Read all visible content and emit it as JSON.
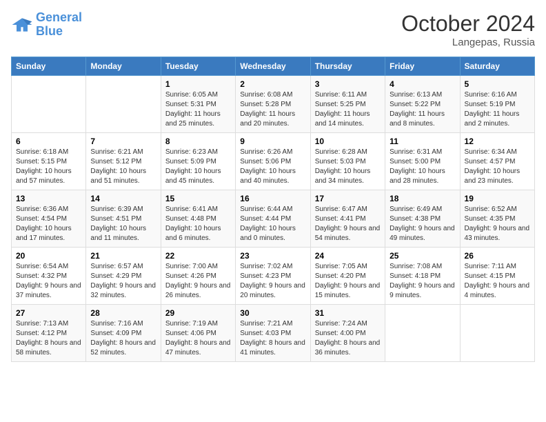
{
  "header": {
    "logo_line1": "General",
    "logo_line2": "Blue",
    "month": "October 2024",
    "location": "Langepas, Russia"
  },
  "weekdays": [
    "Sunday",
    "Monday",
    "Tuesday",
    "Wednesday",
    "Thursday",
    "Friday",
    "Saturday"
  ],
  "weeks": [
    [
      {
        "day": "",
        "sunrise": "",
        "sunset": "",
        "daylight": ""
      },
      {
        "day": "",
        "sunrise": "",
        "sunset": "",
        "daylight": ""
      },
      {
        "day": "1",
        "sunrise": "Sunrise: 6:05 AM",
        "sunset": "Sunset: 5:31 PM",
        "daylight": "Daylight: 11 hours and 25 minutes."
      },
      {
        "day": "2",
        "sunrise": "Sunrise: 6:08 AM",
        "sunset": "Sunset: 5:28 PM",
        "daylight": "Daylight: 11 hours and 20 minutes."
      },
      {
        "day": "3",
        "sunrise": "Sunrise: 6:11 AM",
        "sunset": "Sunset: 5:25 PM",
        "daylight": "Daylight: 11 hours and 14 minutes."
      },
      {
        "day": "4",
        "sunrise": "Sunrise: 6:13 AM",
        "sunset": "Sunset: 5:22 PM",
        "daylight": "Daylight: 11 hours and 8 minutes."
      },
      {
        "day": "5",
        "sunrise": "Sunrise: 6:16 AM",
        "sunset": "Sunset: 5:19 PM",
        "daylight": "Daylight: 11 hours and 2 minutes."
      }
    ],
    [
      {
        "day": "6",
        "sunrise": "Sunrise: 6:18 AM",
        "sunset": "Sunset: 5:15 PM",
        "daylight": "Daylight: 10 hours and 57 minutes."
      },
      {
        "day": "7",
        "sunrise": "Sunrise: 6:21 AM",
        "sunset": "Sunset: 5:12 PM",
        "daylight": "Daylight: 10 hours and 51 minutes."
      },
      {
        "day": "8",
        "sunrise": "Sunrise: 6:23 AM",
        "sunset": "Sunset: 5:09 PM",
        "daylight": "Daylight: 10 hours and 45 minutes."
      },
      {
        "day": "9",
        "sunrise": "Sunrise: 6:26 AM",
        "sunset": "Sunset: 5:06 PM",
        "daylight": "Daylight: 10 hours and 40 minutes."
      },
      {
        "day": "10",
        "sunrise": "Sunrise: 6:28 AM",
        "sunset": "Sunset: 5:03 PM",
        "daylight": "Daylight: 10 hours and 34 minutes."
      },
      {
        "day": "11",
        "sunrise": "Sunrise: 6:31 AM",
        "sunset": "Sunset: 5:00 PM",
        "daylight": "Daylight: 10 hours and 28 minutes."
      },
      {
        "day": "12",
        "sunrise": "Sunrise: 6:34 AM",
        "sunset": "Sunset: 4:57 PM",
        "daylight": "Daylight: 10 hours and 23 minutes."
      }
    ],
    [
      {
        "day": "13",
        "sunrise": "Sunrise: 6:36 AM",
        "sunset": "Sunset: 4:54 PM",
        "daylight": "Daylight: 10 hours and 17 minutes."
      },
      {
        "day": "14",
        "sunrise": "Sunrise: 6:39 AM",
        "sunset": "Sunset: 4:51 PM",
        "daylight": "Daylight: 10 hours and 11 minutes."
      },
      {
        "day": "15",
        "sunrise": "Sunrise: 6:41 AM",
        "sunset": "Sunset: 4:48 PM",
        "daylight": "Daylight: 10 hours and 6 minutes."
      },
      {
        "day": "16",
        "sunrise": "Sunrise: 6:44 AM",
        "sunset": "Sunset: 4:44 PM",
        "daylight": "Daylight: 10 hours and 0 minutes."
      },
      {
        "day": "17",
        "sunrise": "Sunrise: 6:47 AM",
        "sunset": "Sunset: 4:41 PM",
        "daylight": "Daylight: 9 hours and 54 minutes."
      },
      {
        "day": "18",
        "sunrise": "Sunrise: 6:49 AM",
        "sunset": "Sunset: 4:38 PM",
        "daylight": "Daylight: 9 hours and 49 minutes."
      },
      {
        "day": "19",
        "sunrise": "Sunrise: 6:52 AM",
        "sunset": "Sunset: 4:35 PM",
        "daylight": "Daylight: 9 hours and 43 minutes."
      }
    ],
    [
      {
        "day": "20",
        "sunrise": "Sunrise: 6:54 AM",
        "sunset": "Sunset: 4:32 PM",
        "daylight": "Daylight: 9 hours and 37 minutes."
      },
      {
        "day": "21",
        "sunrise": "Sunrise: 6:57 AM",
        "sunset": "Sunset: 4:29 PM",
        "daylight": "Daylight: 9 hours and 32 minutes."
      },
      {
        "day": "22",
        "sunrise": "Sunrise: 7:00 AM",
        "sunset": "Sunset: 4:26 PM",
        "daylight": "Daylight: 9 hours and 26 minutes."
      },
      {
        "day": "23",
        "sunrise": "Sunrise: 7:02 AM",
        "sunset": "Sunset: 4:23 PM",
        "daylight": "Daylight: 9 hours and 20 minutes."
      },
      {
        "day": "24",
        "sunrise": "Sunrise: 7:05 AM",
        "sunset": "Sunset: 4:20 PM",
        "daylight": "Daylight: 9 hours and 15 minutes."
      },
      {
        "day": "25",
        "sunrise": "Sunrise: 7:08 AM",
        "sunset": "Sunset: 4:18 PM",
        "daylight": "Daylight: 9 hours and 9 minutes."
      },
      {
        "day": "26",
        "sunrise": "Sunrise: 7:11 AM",
        "sunset": "Sunset: 4:15 PM",
        "daylight": "Daylight: 9 hours and 4 minutes."
      }
    ],
    [
      {
        "day": "27",
        "sunrise": "Sunrise: 7:13 AM",
        "sunset": "Sunset: 4:12 PM",
        "daylight": "Daylight: 8 hours and 58 minutes."
      },
      {
        "day": "28",
        "sunrise": "Sunrise: 7:16 AM",
        "sunset": "Sunset: 4:09 PM",
        "daylight": "Daylight: 8 hours and 52 minutes."
      },
      {
        "day": "29",
        "sunrise": "Sunrise: 7:19 AM",
        "sunset": "Sunset: 4:06 PM",
        "daylight": "Daylight: 8 hours and 47 minutes."
      },
      {
        "day": "30",
        "sunrise": "Sunrise: 7:21 AM",
        "sunset": "Sunset: 4:03 PM",
        "daylight": "Daylight: 8 hours and 41 minutes."
      },
      {
        "day": "31",
        "sunrise": "Sunrise: 7:24 AM",
        "sunset": "Sunset: 4:00 PM",
        "daylight": "Daylight: 8 hours and 36 minutes."
      },
      {
        "day": "",
        "sunrise": "",
        "sunset": "",
        "daylight": ""
      },
      {
        "day": "",
        "sunrise": "",
        "sunset": "",
        "daylight": ""
      }
    ]
  ]
}
